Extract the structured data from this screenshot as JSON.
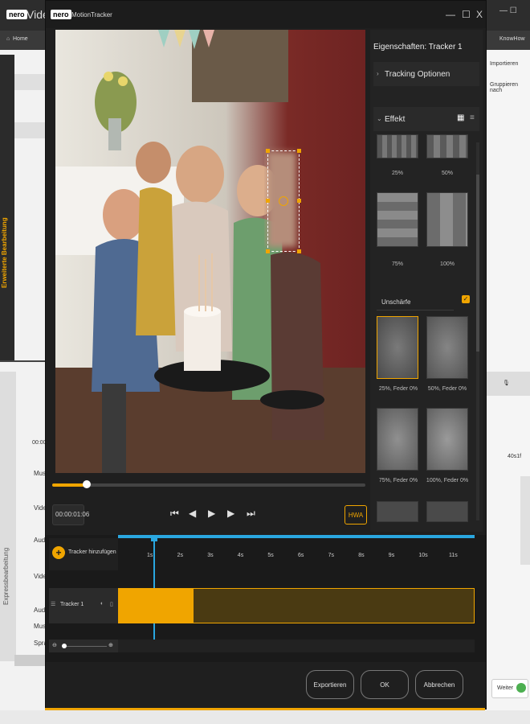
{
  "background_app": {
    "title": "Video",
    "logo": "nero",
    "home_label": "Home",
    "knowhow_label": "KnowHow",
    "import_label": "Importieren",
    "group_label": "Gruppieren nach",
    "left_panel_label": "Erweiterte Bearbeitung",
    "left_panel_label2": "Expressbearbeitung",
    "timecode_partial": "00:00",
    "side_timecode": "40s1f",
    "next_button": "Weiter",
    "track_labels": [
      "Mus",
      "Vide",
      "Aud",
      "Vide",
      "Aud",
      "Mus",
      "Spra"
    ]
  },
  "window": {
    "logo": "nero",
    "title": "MotionTracker",
    "controls": [
      "—",
      "☐",
      "X"
    ]
  },
  "properties": {
    "header": "Eigenschaften: Tracker 1",
    "tracking_options": "Tracking Optionen",
    "effect": "Effekt",
    "mosaic_labels": [
      "25%",
      "50%",
      "75%",
      "100%"
    ],
    "blur_section": "Unschärfe",
    "blur_labels": [
      "25%, Feder 0%",
      "50%, Feder 0%",
      "75%, Feder 0%",
      "100%, Feder 0%"
    ]
  },
  "player": {
    "timecode": "00:00:01:06",
    "hwa_label": "HWA",
    "progress": 0.11
  },
  "timeline": {
    "add_tracker": "Tracker hinzufügen",
    "ticks": [
      "1s",
      "2s",
      "3s",
      "4s",
      "5s",
      "6s",
      "7s",
      "8s",
      "9s",
      "10s",
      "11s"
    ],
    "tracker_name": "Tracker 1",
    "tracked_fraction": 0.21
  },
  "footer": {
    "export": "Exportieren",
    "ok": "OK",
    "cancel": "Abbrechen"
  },
  "colors": {
    "accent": "#f0a500",
    "tracker_dark": "#4a3a12",
    "playhead": "#2aa7e0"
  }
}
